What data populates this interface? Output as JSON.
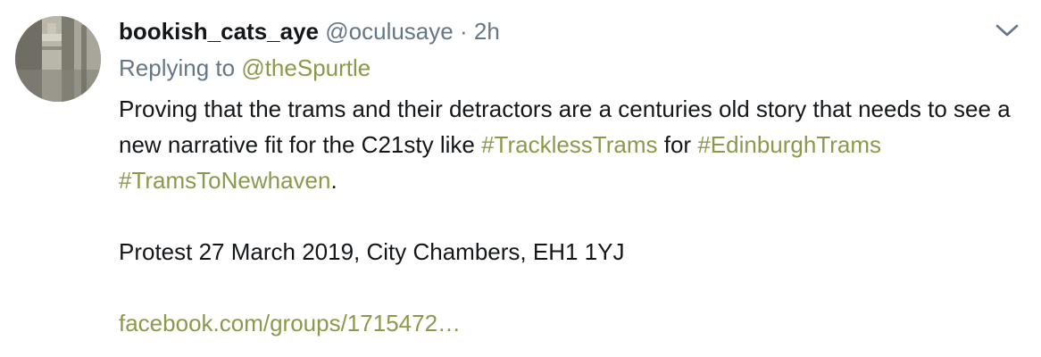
{
  "tweet": {
    "display_name": "bookish_cats_aye",
    "handle": "@oculusaye",
    "separator": "·",
    "time": "2h",
    "replying_prefix": "Replying to",
    "replying_to": "@theSpurtle",
    "text_1": "Proving that the trams and their detractors are a centuries old story that needs to see a new narrative fit for the C21sty like",
    "hashtag_1": "#TracklessTrams",
    "text_2": "for",
    "hashtag_2": "#EdinburghTrams",
    "hashtag_3": "#TramsToNewhaven",
    "text_3": ".",
    "protest_line": "Protest 27 March 2019, City Chambers, EH1 1YJ",
    "link": "facebook.com/groups/1715472…"
  },
  "icons": {
    "avatar": "avatar-photo",
    "menu": "chevron-down-icon"
  },
  "colors": {
    "name": "#14171a",
    "secondary": "#657786",
    "accent_link": "#8a9a4b",
    "body_text": "#14171a",
    "background": "#ffffff"
  }
}
